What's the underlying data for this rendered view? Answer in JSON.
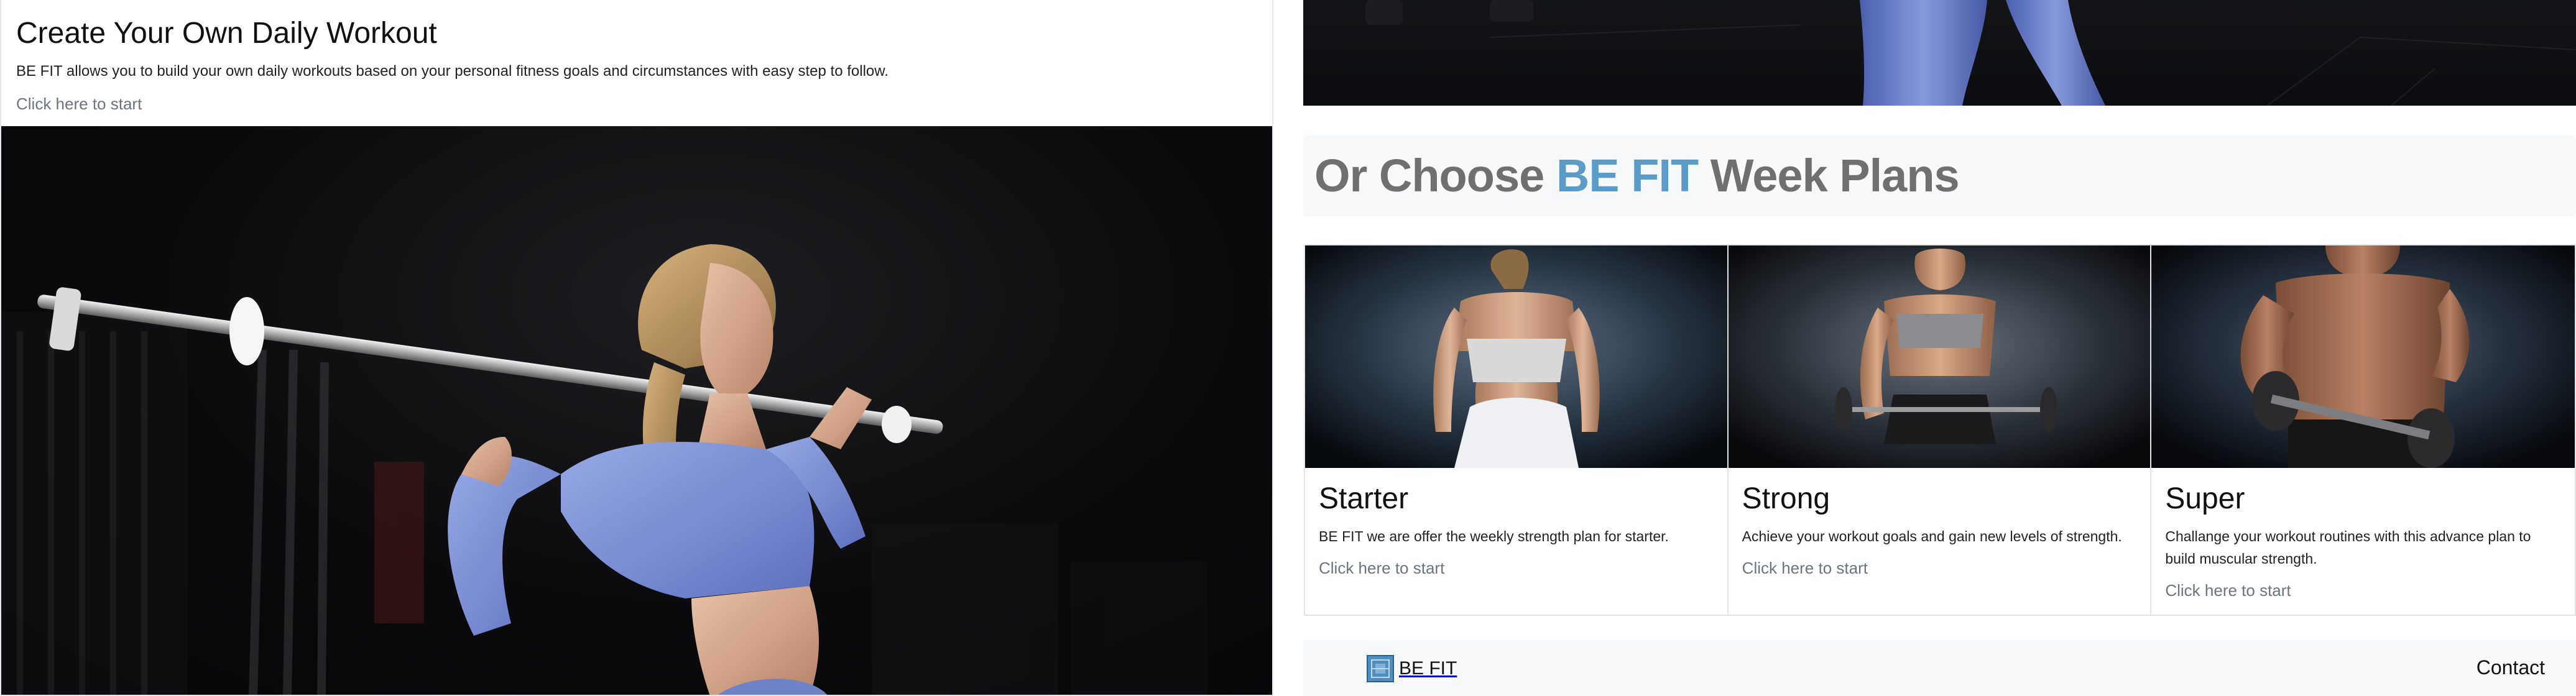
{
  "workout": {
    "title": "Create Your Own Daily Workout",
    "description": "BE FIT allows you to build your own daily workouts based on your personal fitness goals and circumstances with easy step to follow.",
    "link": "Click here to start"
  },
  "plans": {
    "heading_prefix": "Or Choose ",
    "heading_accent": "BE FIT",
    "heading_suffix": " Week Plans",
    "items": [
      {
        "title": "Starter",
        "text": "BE FIT we are offer the weekly strength plan for starter.",
        "link": "Click here to start"
      },
      {
        "title": "Strong",
        "text": "Achieve your workout goals and gain new levels of strength.",
        "link": "Click here to start"
      },
      {
        "title": "Super",
        "text": "Challange your workout routines with this advance plan to build muscular strength.",
        "link": "Click here to start"
      }
    ]
  },
  "footer": {
    "brand": "BE FIT",
    "contact": "Contact"
  },
  "colors": {
    "accent": "#5a9cc7",
    "heading_gray": "#707070",
    "link_gray": "#6c757d",
    "band_bg": "#f8f9fa"
  },
  "icons": {
    "brand_logo": "be-fit-logo-icon"
  }
}
